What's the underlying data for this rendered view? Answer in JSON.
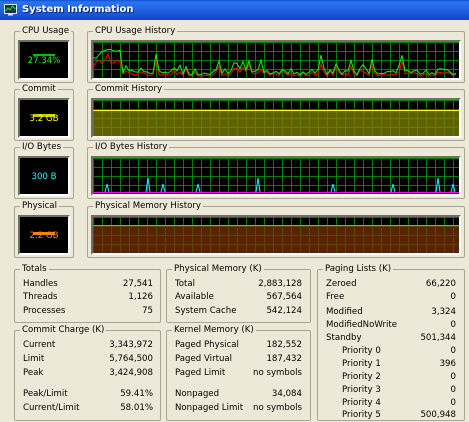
{
  "window": {
    "title": "System Information"
  },
  "colors": {
    "green": "#00ff00",
    "yellow": "#ffff00",
    "cyan": "#00ffff",
    "orange": "#ff8000",
    "red": "#ff0000",
    "grid": "#008000"
  },
  "meters": {
    "cpu": {
      "title": "CPU Usage",
      "value": "27.34%",
      "level": 0.2734
    },
    "commit": {
      "title": "Commit",
      "value": "3.2 GB"
    },
    "io": {
      "title": "I/O Bytes",
      "value": "300 B"
    },
    "physical": {
      "title": "Physical",
      "value": "2.2 GB"
    }
  },
  "histories": {
    "cpu": {
      "title": "CPU Usage History"
    },
    "commit": {
      "title": "Commit History"
    },
    "io": {
      "title": "I/O Bytes History"
    },
    "physical": {
      "title": "Physical Memory History"
    }
  },
  "totals": {
    "title": "Totals",
    "rows": [
      {
        "label": "Handles",
        "value": "27,541"
      },
      {
        "label": "Threads",
        "value": "1,126"
      },
      {
        "label": "Processes",
        "value": "75"
      }
    ]
  },
  "physical_memory": {
    "title": "Physical Memory (K)",
    "rows": [
      {
        "label": "Total",
        "value": "2,883,128"
      },
      {
        "label": "Available",
        "value": "567,564"
      },
      {
        "label": "System Cache",
        "value": "542,124"
      }
    ]
  },
  "paging_lists": {
    "title": "Paging Lists (K)",
    "rows": [
      {
        "label": "Zeroed",
        "value": "66,220"
      },
      {
        "label": "Free",
        "value": "0"
      },
      {
        "label": "Modified",
        "value": "3,324"
      },
      {
        "label": "ModifiedNoWrite",
        "value": "0"
      },
      {
        "label": "Standby",
        "value": "501,344"
      },
      {
        "label": "Priority 0",
        "value": "0"
      },
      {
        "label": "Priority 1",
        "value": "396"
      },
      {
        "label": "Priority 2",
        "value": "0"
      },
      {
        "label": "Priority 3",
        "value": "0"
      },
      {
        "label": "Priority 4",
        "value": "0"
      },
      {
        "label": "Priority 5",
        "value": "500,948"
      }
    ]
  },
  "commit_charge": {
    "title": "Commit Charge (K)",
    "rows": [
      {
        "label": "Current",
        "value": "3,343,972"
      },
      {
        "label": "Limit",
        "value": "5,764,500"
      },
      {
        "label": "Peak",
        "value": "3,424,908"
      },
      {
        "label": "Peak/Limit",
        "value": "59.41%"
      },
      {
        "label": "Current/Limit",
        "value": "58.01%"
      }
    ]
  },
  "kernel_memory": {
    "title": "Kernel Memory (K)",
    "rows": [
      {
        "label": "Paged Physical",
        "value": "182,552"
      },
      {
        "label": "Paged Virtual",
        "value": "187,432"
      },
      {
        "label": "Paged Limit",
        "value": "no symbols"
      },
      {
        "label": "Nonpaged",
        "value": "34,084"
      },
      {
        "label": "Nonpaged Limit",
        "value": "no symbols"
      }
    ]
  }
}
